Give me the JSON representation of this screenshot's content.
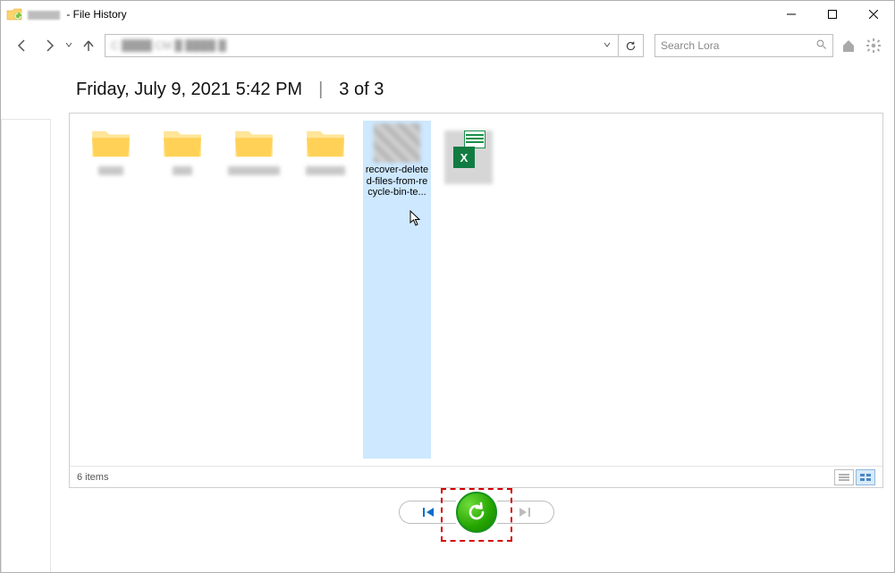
{
  "titlebar": {
    "title_suffix": " - File History"
  },
  "nav": {
    "search_placeholder": "Search Lora"
  },
  "header": {
    "timestamp": "Friday, July 9, 2021 5:42 PM",
    "separator": "|",
    "position": "3 of 3"
  },
  "items": [
    {
      "type": "folder",
      "label": ""
    },
    {
      "type": "folder",
      "label": ""
    },
    {
      "type": "folder",
      "label": ""
    },
    {
      "type": "folder",
      "label": ""
    },
    {
      "type": "image",
      "label": "recover-deleted-files-from-recycle-bin-te...",
      "selected": true
    },
    {
      "type": "excel",
      "label": ""
    }
  ],
  "status": {
    "count_text": "6 items"
  }
}
